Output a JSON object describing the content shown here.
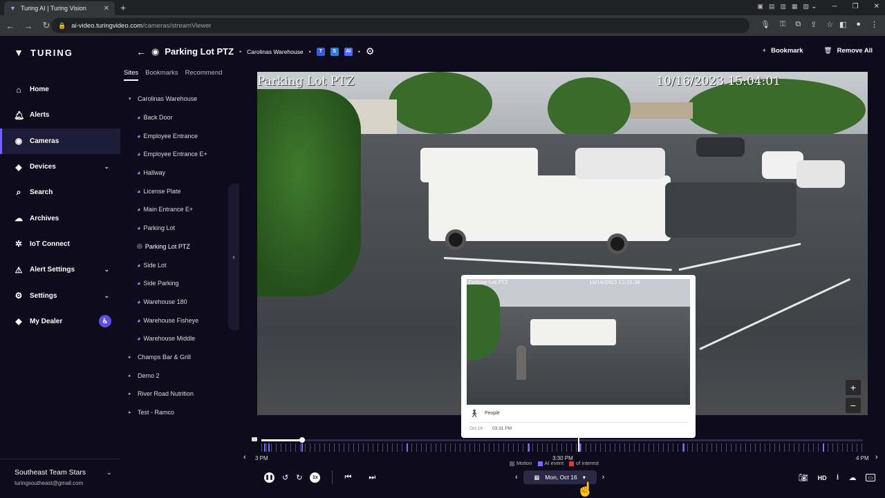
{
  "browser": {
    "tab_title": "Turing AI | Turing Vision",
    "url_host": "ai-video.turingvideo.com",
    "url_path": "/cameras/streamViewer"
  },
  "app": {
    "logo_text": "TURING",
    "nav": [
      {
        "label": "Home",
        "icon": "home-icon"
      },
      {
        "label": "Alerts",
        "icon": "bell-icon"
      },
      {
        "label": "Cameras",
        "icon": "camera-icon",
        "active": true
      },
      {
        "label": "Devices",
        "icon": "devices-icon",
        "expandable": true
      },
      {
        "label": "Search",
        "icon": "search-icon"
      },
      {
        "label": "Archives",
        "icon": "cloud-upload-icon"
      },
      {
        "label": "IoT Connect",
        "icon": "iot-icon"
      },
      {
        "label": "Alert Settings",
        "icon": "alert-settings-icon",
        "expandable": true
      },
      {
        "label": "Settings",
        "icon": "gear-icon",
        "expandable": true
      },
      {
        "label": "My Dealer",
        "icon": "dealer-icon",
        "badge": true
      }
    ],
    "user": {
      "name": "Southeast Team Stars",
      "email": "turingsoutheast@gmail.com"
    }
  },
  "header": {
    "title": "Parking Lot PTZ",
    "site": "Carolinas Warehouse",
    "tags": [
      "T",
      "S",
      "AI"
    ],
    "bookmark_label": "Bookmark",
    "remove_all_label": "Remove All"
  },
  "panel": {
    "tabs": [
      "Sites",
      "Bookmarks",
      "Recommend"
    ],
    "active_tab": "Sites",
    "tree": [
      {
        "label": "Carolinas Warehouse",
        "type": "site",
        "expanded": true
      },
      {
        "label": "Back Door",
        "type": "cam"
      },
      {
        "label": "Employee Entrance",
        "type": "cam"
      },
      {
        "label": "Employee Entrance E+",
        "type": "cam"
      },
      {
        "label": "Hallway",
        "type": "cam"
      },
      {
        "label": "License Plate",
        "type": "cam"
      },
      {
        "label": "Main Entrance E+",
        "type": "cam"
      },
      {
        "label": "Parking Lot",
        "type": "cam"
      },
      {
        "label": "Parking Lot PTZ",
        "type": "cam",
        "active": true
      },
      {
        "label": "Side Lot",
        "type": "cam"
      },
      {
        "label": "Side Parking",
        "type": "cam"
      },
      {
        "label": "Warehouse 180",
        "type": "cam"
      },
      {
        "label": "Warehouse Fisheye",
        "type": "cam"
      },
      {
        "label": "Warehouse Middle",
        "type": "cam"
      },
      {
        "label": "Champs Bar & Grill",
        "type": "site"
      },
      {
        "label": "Demo 2",
        "type": "site"
      },
      {
        "label": "River Road Nutrition",
        "type": "site"
      },
      {
        "label": "Test - Ramco",
        "type": "site"
      }
    ]
  },
  "video": {
    "overlay_title": "Parking Lot PTZ",
    "overlay_time": "10/16/2023 15:04:01"
  },
  "popup": {
    "thumb_title": "Parking Lot PTZ",
    "thumb_time": "10/16/2023 15:31:34",
    "event_type": "People",
    "date": "Oct 16",
    "time": "03:31 PM"
  },
  "timeline": {
    "start_label": "3 PM",
    "mid_label": "3:30 PM",
    "end_label": "4 PM",
    "legend": [
      {
        "label": "Motion",
        "color": "#555566"
      },
      {
        "label": "AI event",
        "color": "#7a70ff"
      },
      {
        "label": "of interest",
        "color": "#e03a3a"
      }
    ],
    "speed": "1x",
    "date": "Mon, Oct 16",
    "quality": "HD"
  },
  "colors": {
    "accent": "#6e63ff",
    "bg": "#0d0b1c"
  }
}
